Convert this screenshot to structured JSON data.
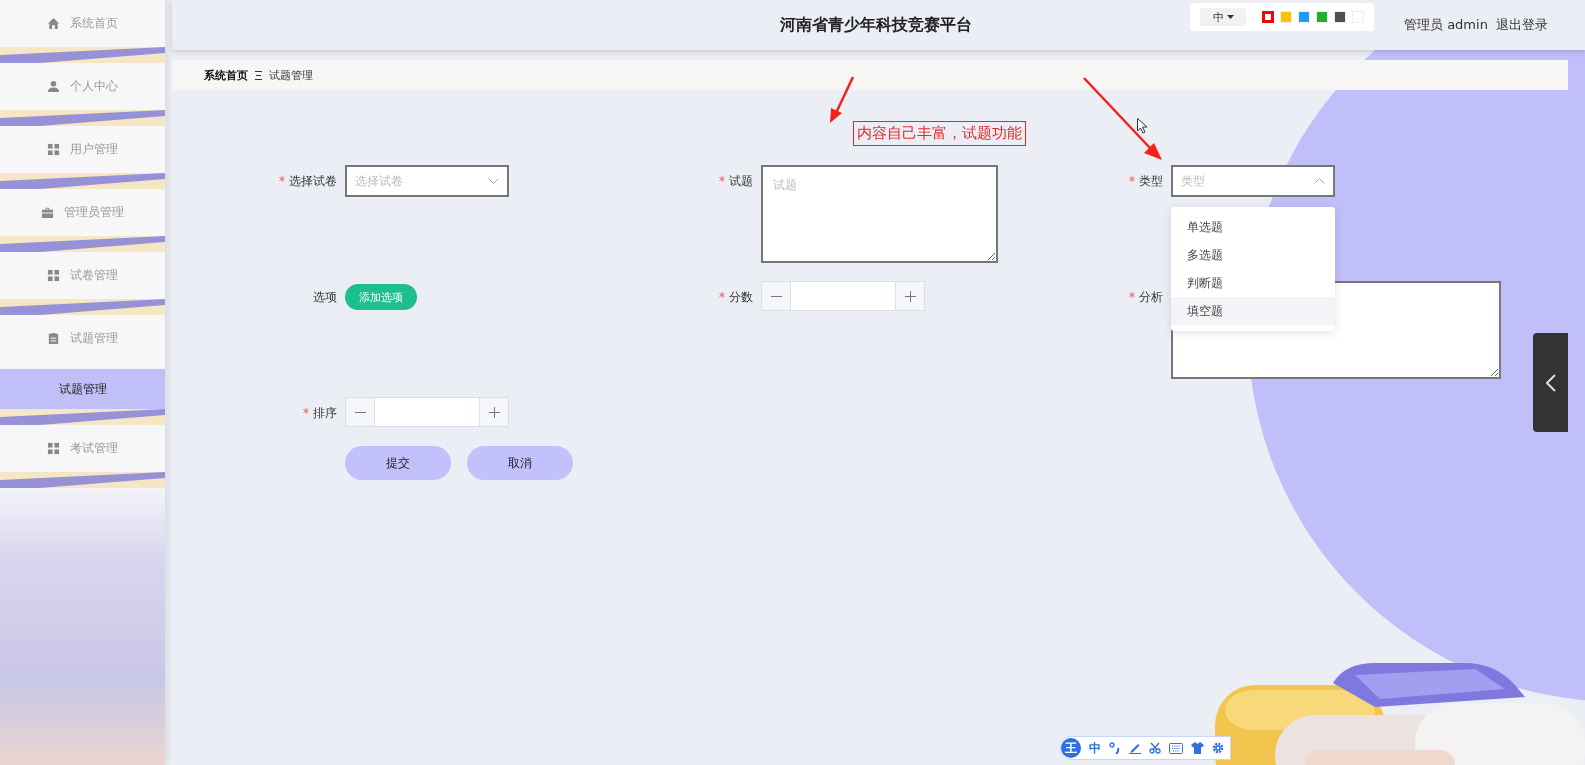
{
  "header": {
    "title": "河南省青少年科技竞赛平台",
    "language": "中",
    "theme_colors": [
      {
        "color": "#ff0000",
        "selected": true
      },
      {
        "color": "#ffc000",
        "selected": false
      },
      {
        "color": "#1e9bff",
        "selected": false
      },
      {
        "color": "#20b02a",
        "selected": false
      },
      {
        "color": "#505050",
        "selected": false
      },
      {
        "color": "#ffffff",
        "selected": false
      }
    ],
    "user": "管理员 admin",
    "logout": "退出登录"
  },
  "sidebar": {
    "items": [
      {
        "label": "系统首页",
        "selected": false
      },
      {
        "label": "个人中心",
        "selected": false
      },
      {
        "label": "用户管理",
        "selected": false
      },
      {
        "label": "管理员管理",
        "selected": false
      },
      {
        "label": "试卷管理",
        "selected": false
      },
      {
        "label": "试题管理",
        "selected": false,
        "expanded": true,
        "children": [
          {
            "label": "试题管理",
            "selected": true
          }
        ]
      },
      {
        "label": "考试管理",
        "selected": false
      }
    ]
  },
  "breadcrumb": [
    "系统首页",
    "试题管理"
  ],
  "annotation": "内容自己丰富，试题功能",
  "form": {
    "rows": [
      [
        {
          "kind": "select",
          "label": "选择试卷",
          "required": true,
          "placeholder": "选择试卷",
          "expanded": false
        },
        {
          "kind": "textarea",
          "label": "试题",
          "required": true,
          "placeholder": "试题"
        },
        {
          "kind": "select",
          "label": "类型",
          "required": true,
          "placeholder": "类型",
          "expanded": true,
          "options": [
            {
              "label": "单选题",
              "highlighted": false
            },
            {
              "label": "多选题",
              "highlighted": false
            },
            {
              "label": "判断题",
              "highlighted": false
            },
            {
              "label": "填空题",
              "highlighted": true
            }
          ]
        }
      ],
      [
        {
          "kind": "button",
          "label": "选项",
          "required": false,
          "button": "添加选项"
        },
        {
          "kind": "number",
          "label": "分数",
          "required": true
        },
        {
          "kind": "textarea",
          "label": "分析",
          "required": true
        }
      ],
      [
        {
          "kind": "number",
          "label": "排序",
          "required": true
        }
      ]
    ],
    "buttons": [
      "提交",
      "取消"
    ]
  },
  "ime_toolbar": {
    "logo": "王",
    "mode": "中"
  }
}
